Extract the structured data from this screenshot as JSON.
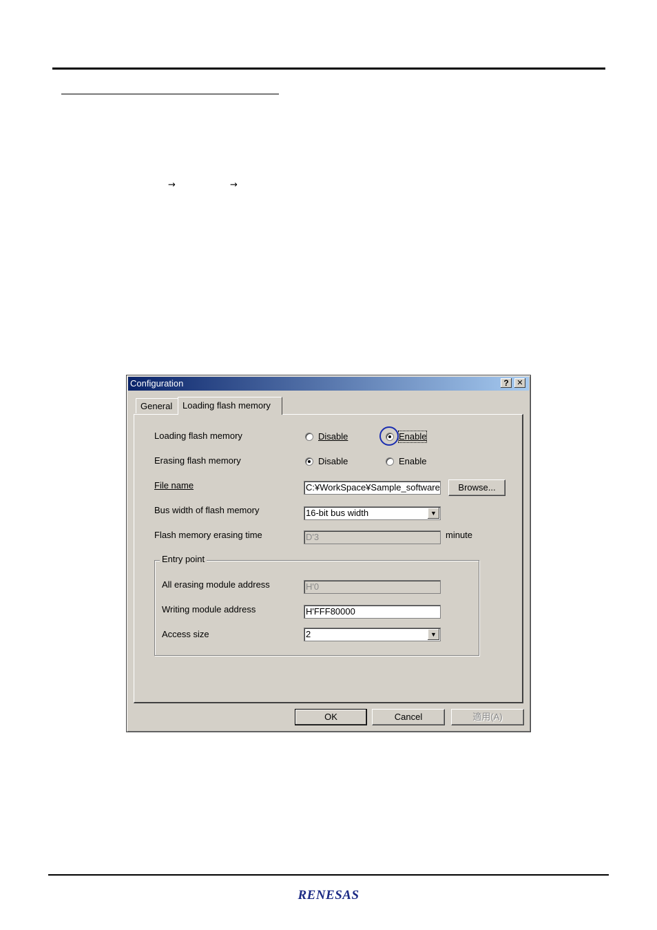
{
  "doc": {
    "arrow1": "→",
    "arrow2": "→"
  },
  "logo": {
    "text": "RENESAS"
  },
  "dialog": {
    "title": "Configuration",
    "help_btn": "?",
    "close_btn": "✕",
    "tabs": [
      {
        "label": "General"
      },
      {
        "label": "Loading flash memory"
      }
    ],
    "loading_flash": {
      "label": "Loading flash memory",
      "options": [
        "Disable",
        "Enable"
      ],
      "selected": "Enable"
    },
    "erasing_flash": {
      "label": "Erasing flash memory",
      "options": [
        "Disable",
        "Enable"
      ],
      "selected": "Disable"
    },
    "file_name": {
      "label": "File name",
      "value": "C:¥WorkSpace¥Sample_software",
      "browse": "Browse..."
    },
    "bus_width": {
      "label": "Bus width of flash memory",
      "value": "16-bit bus width"
    },
    "erase_time": {
      "label": "Flash memory erasing time",
      "value": "D'3",
      "unit": "minute"
    },
    "entry_point": {
      "title": "Entry point",
      "all_erase_label": "All erasing module address",
      "all_erase_value": "H'0",
      "writing_label": "Writing module address",
      "writing_value": "H'FFF80000",
      "access_label": "Access size",
      "access_value": "2"
    },
    "buttons": {
      "ok": "OK",
      "cancel": "Cancel",
      "apply": "適用(A)"
    },
    "dropdown_icon": "▼"
  },
  "colors": {
    "titlebar_start": "#0a246a",
    "titlebar_end": "#a6caf0",
    "face": "#d4d0c8",
    "highlight_circle": "#1a2db0",
    "logo": "#1b2a84"
  }
}
